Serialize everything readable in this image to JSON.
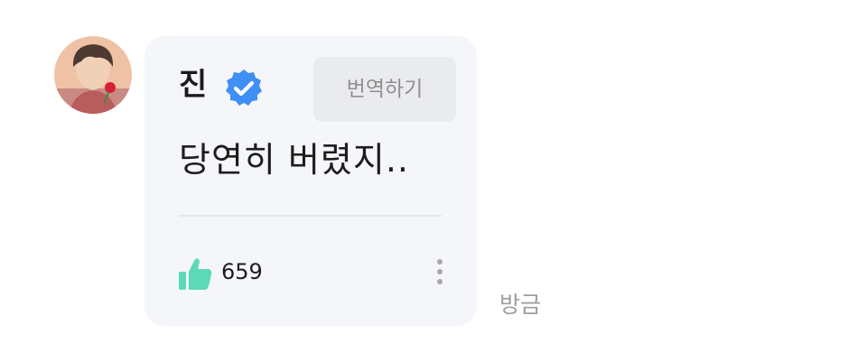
{
  "post": {
    "author": "진",
    "verified": true,
    "translate_label": "번역하기",
    "message": "당연히 버렸지..",
    "like_count": "659",
    "timestamp": "방금"
  },
  "colors": {
    "bubble": "#f4f6f9",
    "verified_badge": "#3f8ff4",
    "like_icon": "#5cd9b6",
    "translate_button": "#e9ebee",
    "timestamp": "#9e9e9e"
  },
  "icons": {
    "verified": "verified-badge-icon",
    "like": "thumbs-up-icon",
    "more": "more-vertical-icon"
  }
}
